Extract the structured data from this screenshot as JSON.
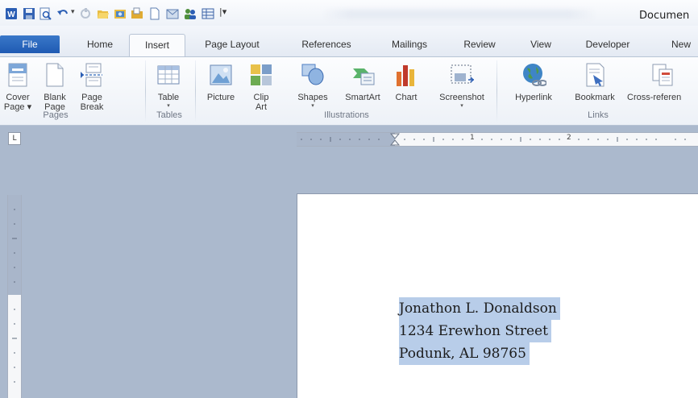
{
  "window": {
    "title": "Documen"
  },
  "quick_access": {
    "icons": [
      "word-app-icon",
      "save-icon",
      "print-preview-icon",
      "undo-icon",
      "undo-dropdown-icon",
      "redo-icon",
      "open-folder-icon",
      "picture-icon",
      "folder-icon",
      "new-document-icon",
      "mail-icon",
      "people-icon",
      "table-icon",
      "customize-dropdown-icon"
    ]
  },
  "tabs": [
    "File",
    "Home",
    "Insert",
    "Page Layout",
    "References",
    "Mailings",
    "Review",
    "View",
    "Developer",
    "New"
  ],
  "active_tab": "Insert",
  "ribbon": {
    "groups": [
      {
        "name": "Pages",
        "buttons": [
          {
            "line1": "Cover",
            "line2": "Page ▾",
            "icon": "cover-page-icon"
          },
          {
            "line1": "Blank",
            "line2": "Page",
            "icon": "blank-page-icon"
          },
          {
            "line1": "Page",
            "line2": "Break",
            "icon": "page-break-icon"
          }
        ]
      },
      {
        "name": "Tables",
        "buttons": [
          {
            "line1": "Table",
            "line2": "▾",
            "icon": "table-icon"
          }
        ]
      },
      {
        "name": "Illustrations",
        "buttons": [
          {
            "line1": "Picture",
            "line2": "",
            "icon": "picture-icon"
          },
          {
            "line1": "Clip",
            "line2": "Art",
            "icon": "clip-art-icon"
          },
          {
            "line1": "Shapes",
            "line2": "▾",
            "icon": "shapes-icon"
          },
          {
            "line1": "SmartArt",
            "line2": "",
            "icon": "smartart-icon"
          },
          {
            "line1": "Chart",
            "line2": "",
            "icon": "chart-icon"
          },
          {
            "line1": "Screenshot",
            "line2": "▾",
            "icon": "screenshot-icon"
          }
        ]
      },
      {
        "name": "Links",
        "buttons": [
          {
            "line1": "Hyperlink",
            "line2": "",
            "icon": "hyperlink-icon"
          },
          {
            "line1": "Bookmark",
            "line2": "",
            "icon": "bookmark-icon"
          },
          {
            "line1": "Cross-referen",
            "line2": "",
            "icon": "cross-reference-icon"
          }
        ]
      }
    ]
  },
  "ruler": {
    "marks": [
      "1",
      "2"
    ],
    "tab_selector": "L"
  },
  "document": {
    "selected_lines": [
      "Jonathon L. Donaldson",
      "1234 Erewhon Street",
      "Podunk, AL  98765"
    ]
  },
  "colors": {
    "file_tab": "#2a66bd",
    "selection": "#b8cde9",
    "workspace": "#abb9cd",
    "ribbon": "#f3f6fb"
  }
}
